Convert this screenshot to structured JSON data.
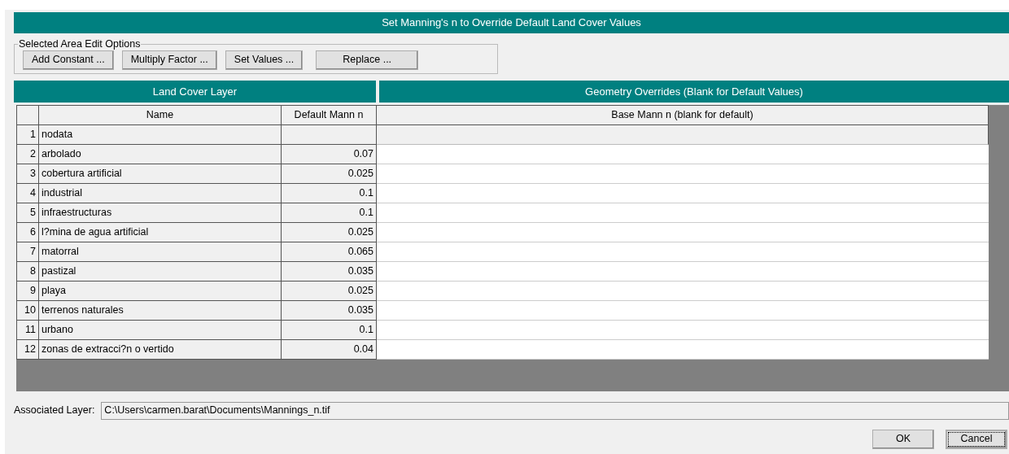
{
  "title": "Set Manning's n to Override Default Land Cover Values",
  "edit_options": {
    "label": "Selected Area Edit Options",
    "buttons": [
      "Add Constant ...",
      "Multiply Factor ...",
      "Set Values ...",
      "Replace ..."
    ]
  },
  "sections": [
    "Land Cover Layer",
    "Geometry Overrides (Blank for Default Values)"
  ],
  "table": {
    "columns": [
      "Name",
      "Default Mann n",
      "Base Mann n (blank for default)"
    ],
    "rows": [
      {
        "index": "1",
        "name": "nodata",
        "default": "",
        "editable": false
      },
      {
        "index": "2",
        "name": "arbolado",
        "default": "0.07",
        "editable": true
      },
      {
        "index": "3",
        "name": "cobertura artificial",
        "default": "0.025",
        "editable": true
      },
      {
        "index": "4",
        "name": "industrial",
        "default": "0.1",
        "editable": true
      },
      {
        "index": "5",
        "name": "infraestructuras",
        "default": "0.1",
        "editable": true
      },
      {
        "index": "6",
        "name": "l?mina de agua artificial",
        "default": "0.025",
        "editable": true
      },
      {
        "index": "7",
        "name": "matorral",
        "default": "0.065",
        "editable": true
      },
      {
        "index": "8",
        "name": "pastizal",
        "default": "0.035",
        "editable": true
      },
      {
        "index": "9",
        "name": "playa",
        "default": "0.025",
        "editable": true
      },
      {
        "index": "10",
        "name": "terrenos naturales",
        "default": "0.035",
        "editable": true
      },
      {
        "index": "11",
        "name": "urbano",
        "default": "0.1",
        "editable": true
      },
      {
        "index": "12",
        "name": "zonas de extracci?n o vertido",
        "default": "0.04",
        "editable": true
      }
    ]
  },
  "associated_layer": {
    "label": "Associated Layer:",
    "value": "C:\\Users\\carmen.barat\\Documents\\Mannings_n.tif"
  },
  "buttons": [
    {
      "label": "OK",
      "focused": false
    },
    {
      "label": "Cancel",
      "focused": true
    }
  ]
}
